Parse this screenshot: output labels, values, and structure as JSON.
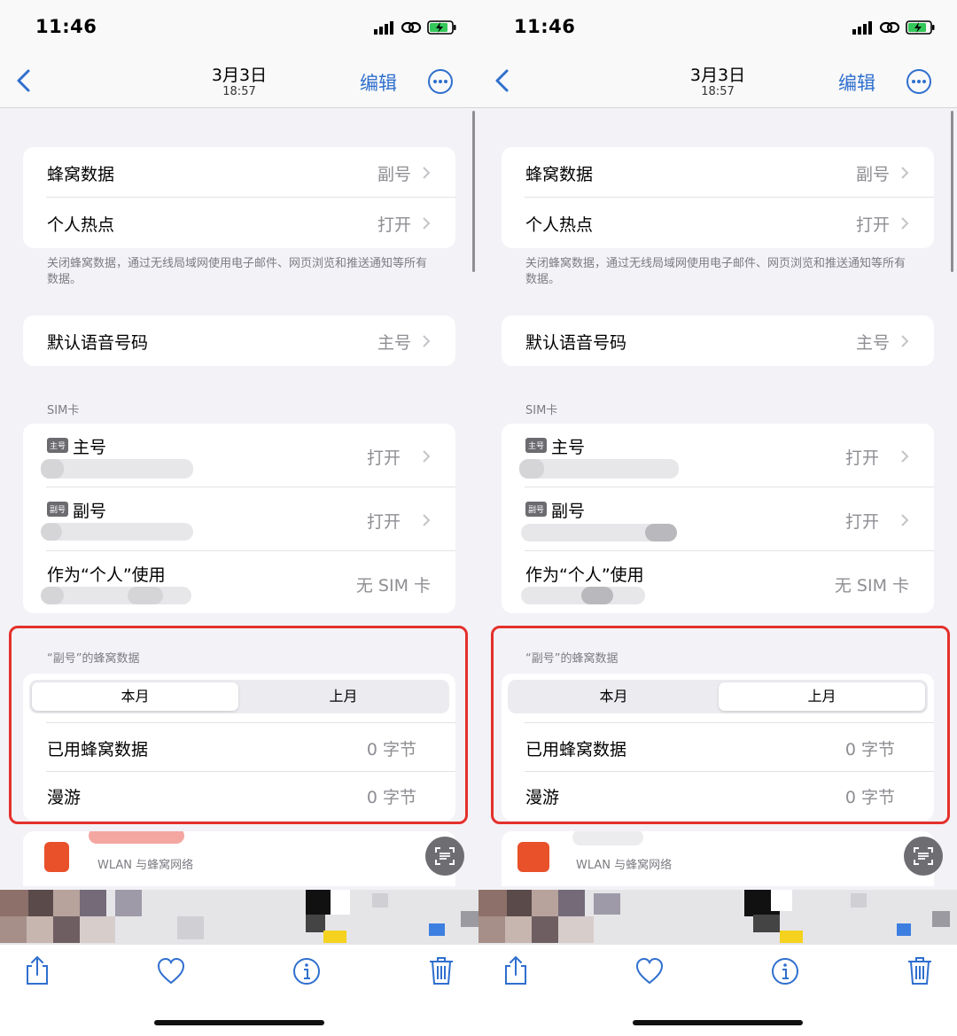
{
  "colors": {
    "accent": "#2f6fce",
    "highlight": "#e5302c",
    "value": "#8e8e93"
  },
  "panels": [
    {
      "status": {
        "time": "11:46"
      },
      "nav": {
        "date": "3月3日",
        "time": "18:57",
        "edit": "编辑"
      },
      "cellular": {
        "label": "蜂窝数据",
        "value": "副号"
      },
      "hotspot": {
        "label": "个人热点",
        "value": "打开"
      },
      "footer": "关闭蜂窝数据，通过无线局域网使用电子邮件、网页浏览和推送通知等所有数据。",
      "voice": {
        "label": "默认语音号码",
        "value": "主号"
      },
      "sim_header": "SIM卡",
      "sim_primary": {
        "badge": "主号",
        "label": "主号",
        "value": "打开"
      },
      "sim_secondary": {
        "badge": "副号",
        "label": "副号",
        "value": "打开"
      },
      "personal": {
        "label": "作为“个人”使用",
        "value": "无 SIM 卡"
      },
      "usage_header": "“副号”的蜂窝数据",
      "segment": {
        "options": [
          "本月",
          "上月"
        ],
        "selected": 0
      },
      "used": {
        "label": "已用蜂窝数据",
        "value": "0 字节"
      },
      "roaming": {
        "label": "漫游",
        "value": "0 字节"
      },
      "wlan_label": "WLAN 与蜂窝网络"
    },
    {
      "status": {
        "time": "11:46"
      },
      "nav": {
        "date": "3月3日",
        "time": "18:57",
        "edit": "编辑"
      },
      "cellular": {
        "label": "蜂窝数据",
        "value": "副号"
      },
      "hotspot": {
        "label": "个人热点",
        "value": "打开"
      },
      "footer": "关闭蜂窝数据，通过无线局域网使用电子邮件、网页浏览和推送通知等所有数据。",
      "voice": {
        "label": "默认语音号码",
        "value": "主号"
      },
      "sim_header": "SIM卡",
      "sim_primary": {
        "badge": "主号",
        "label": "主号",
        "value": "打开"
      },
      "sim_secondary": {
        "badge": "副号",
        "label": "副号",
        "value": "打开"
      },
      "personal": {
        "label": "作为“个人”使用",
        "value": "无 SIM 卡"
      },
      "usage_header": "“副号”的蜂窝数据",
      "segment": {
        "options": [
          "本月",
          "上月"
        ],
        "selected": 1
      },
      "used": {
        "label": "已用蜂窝数据",
        "value": "0 字节"
      },
      "roaming": {
        "label": "漫游",
        "value": "0 字节"
      },
      "wlan_label": "WLAN 与蜂窝网络"
    }
  ]
}
